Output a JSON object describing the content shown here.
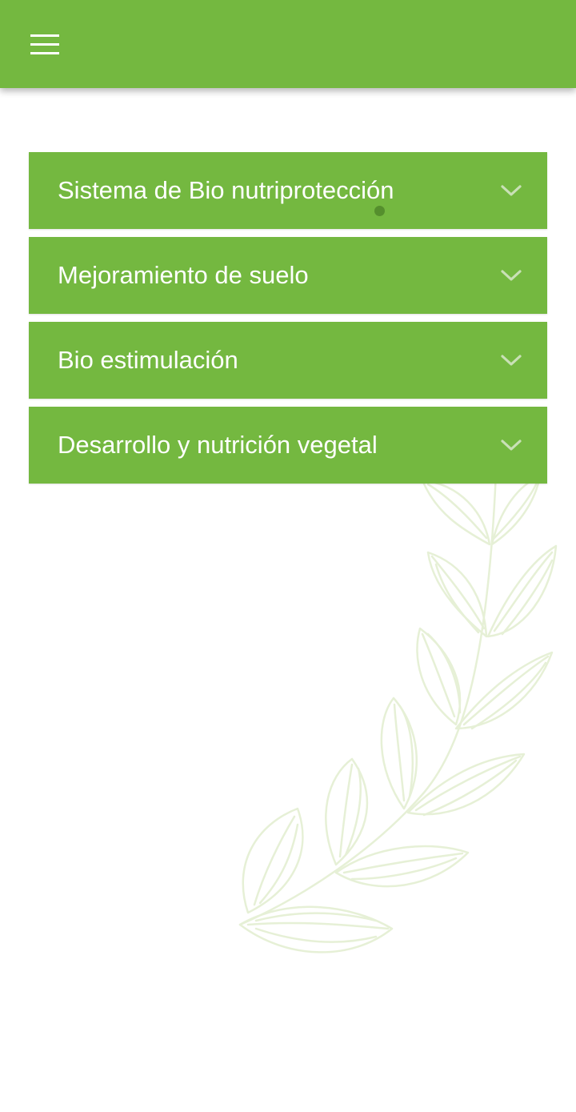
{
  "header": {
    "menu_icon": "hamburger-menu-icon",
    "background_color": "#74b840"
  },
  "accordion": {
    "item_color": "#74b840",
    "chevron_color": "#c9e0b6",
    "items": [
      {
        "label": "Sistema de Bio nutriprotección",
        "icon": "chevron-down-icon"
      },
      {
        "label": "Mejoramiento de suelo",
        "icon": "chevron-down-icon"
      },
      {
        "label": "Bio estimulación",
        "icon": "chevron-down-icon"
      },
      {
        "label": "Desarrollo y nutrición vegetal",
        "icon": "chevron-down-icon"
      }
    ]
  },
  "background": {
    "decoration": "leaf-branch-illustration",
    "decoration_color": "#e6f0d6"
  }
}
